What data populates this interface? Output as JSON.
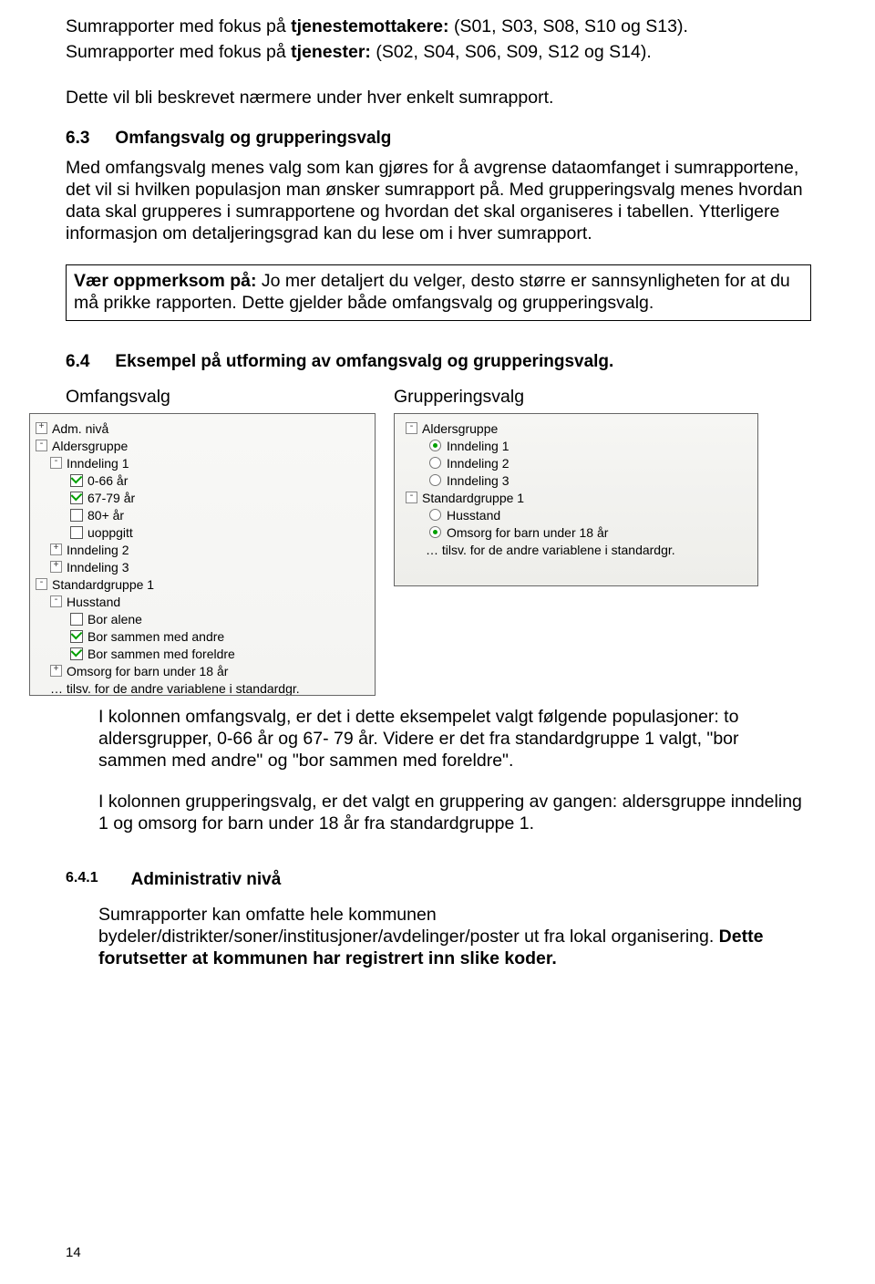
{
  "intro": {
    "line1_a": "Sumrapporter med fokus på ",
    "line1_bold": "tjenestemottakere:",
    "line1_b": " (S01, S03, S08, S10 og S13).",
    "line2_a": "Sumrapporter med fokus på ",
    "line2_bold": "tjenester:",
    "line2_b": " (S02, S04, S06, S09, S12 og S14).",
    "line3": "Dette vil bli beskrevet nærmere under hver enkelt sumrapport."
  },
  "section63": {
    "num": "6.3",
    "title": "Omfangsvalg og grupperingsvalg",
    "body": "Med omfangsvalg menes valg som kan gjøres for å avgrense dataomfanget i sumrapportene, det vil si hvilken populasjon man ønsker sumrapport på. Med grupperingsvalg menes hvordan data skal grupperes i sumrapportene og hvordan det skal organiseres i tabellen. Ytterligere informasjon om detaljeringsgrad kan du lese om i hver sumrapport.",
    "callout_bold": "Vær oppmerksom på:",
    "callout_rest": " Jo mer detaljert du velger, desto større er sannsynligheten for at du må prikke rapporten. Dette gjelder både omfangsvalg og grupperingsvalg."
  },
  "section64": {
    "num": "6.4",
    "title": "Eksempel på utforming av omfangsvalg og grupperingsvalg.",
    "left_label": "Omfangsvalg",
    "right_label": "Grupperingsvalg",
    "left_tree": {
      "adm": "Adm. nivå",
      "alders": "Aldersgruppe",
      "ind1": "Inndeling 1",
      "a1": "0-66 år",
      "a2": "67-79 år",
      "a3": "80+ år",
      "a4": "uoppgitt",
      "ind2": "Inndeling 2",
      "ind3": "Inndeling 3",
      "std1": "Standardgruppe 1",
      "hus": "Husstand",
      "b1": "Bor alene",
      "b2": "Bor sammen med andre",
      "b3": "Bor sammen med foreldre",
      "omsorg": "Omsorg for barn under 18 år",
      "foot": "… tilsv. for de andre variablene i standardgr."
    },
    "right_tree": {
      "alders": "Aldersgruppe",
      "ind1": "Inndeling 1",
      "ind2": "Inndeling 2",
      "ind3": "Inndeling 3",
      "std1": "Standardgruppe 1",
      "hus": "Husstand",
      "omsorg": "Omsorg for barn under 18 år",
      "foot": "… tilsv. for de andre variablene i standardgr."
    },
    "after1": "I kolonnen omfangsvalg, er det i dette eksempelet valgt følgende populasjoner: to aldersgrupper, 0-66 år og 67- 79 år. Videre er det fra standardgruppe 1 valgt, \"bor sammen med andre\" og \"bor sammen med foreldre\".",
    "after2": "I kolonnen grupperingsvalg, er det valgt en gruppering av gangen: aldersgruppe inndeling 1 og omsorg for barn under 18 år fra standardgruppe 1."
  },
  "section641": {
    "num": "6.4.1",
    "title": "Administrativ nivå",
    "body_a": "Sumrapporter kan omfatte hele kommunen bydeler/distrikter/soner/institusjoner/avdelinger/poster ut fra lokal organisering. ",
    "body_bold": "Dette forutsetter at kommunen har registrert inn slike koder."
  },
  "page_num": "14"
}
